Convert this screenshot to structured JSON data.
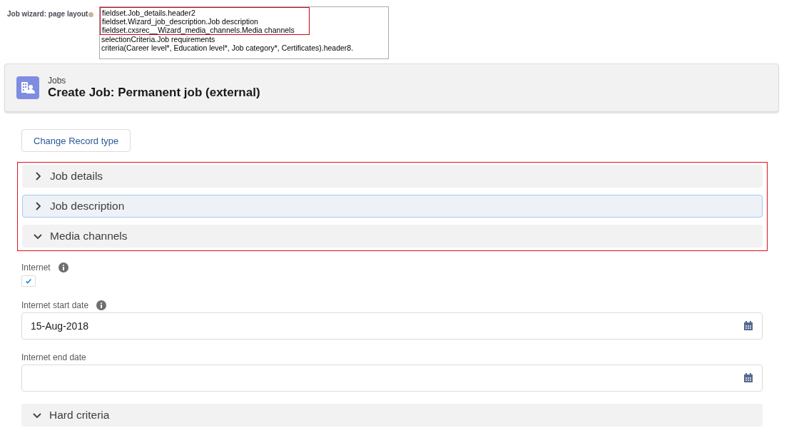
{
  "layout_setting": {
    "label": "Job wizard: page layout",
    "lines": [
      {
        "text": "fieldset.Job_details.header2",
        "highlighted": true
      },
      {
        "text": "fieldset.Wizard_job_description.Job description",
        "highlighted": true
      },
      {
        "text": "fieldset.cxsrec__Wizard_media_channels.Media channels",
        "highlighted": true
      },
      {
        "text": "selectionCriteria.Job requirements",
        "highlighted": false
      },
      {
        "text": "criteria(Career level*, Education level*, Job category*, Certificates).header8.",
        "highlighted": false
      }
    ]
  },
  "header": {
    "object": "Jobs",
    "title": "Create Job: Permanent job (external)"
  },
  "change_record_type_button": "Change Record type",
  "sections": [
    {
      "title": "Job details",
      "expanded": false,
      "focused": false
    },
    {
      "title": "Job description",
      "expanded": false,
      "focused": true
    },
    {
      "title": "Media channels",
      "expanded": true,
      "focused": false
    }
  ],
  "fields": [
    {
      "kind": "checkbox",
      "label": "Internet",
      "info": true,
      "checked": true
    },
    {
      "kind": "date",
      "label": "Internet start date",
      "info": true,
      "value": "15-Aug-2018"
    },
    {
      "kind": "date",
      "label": "Internet end date",
      "info": false
    }
  ],
  "more_sections": [
    {
      "title": "Hard criteria",
      "expanded": true,
      "focused": false
    }
  ]
}
